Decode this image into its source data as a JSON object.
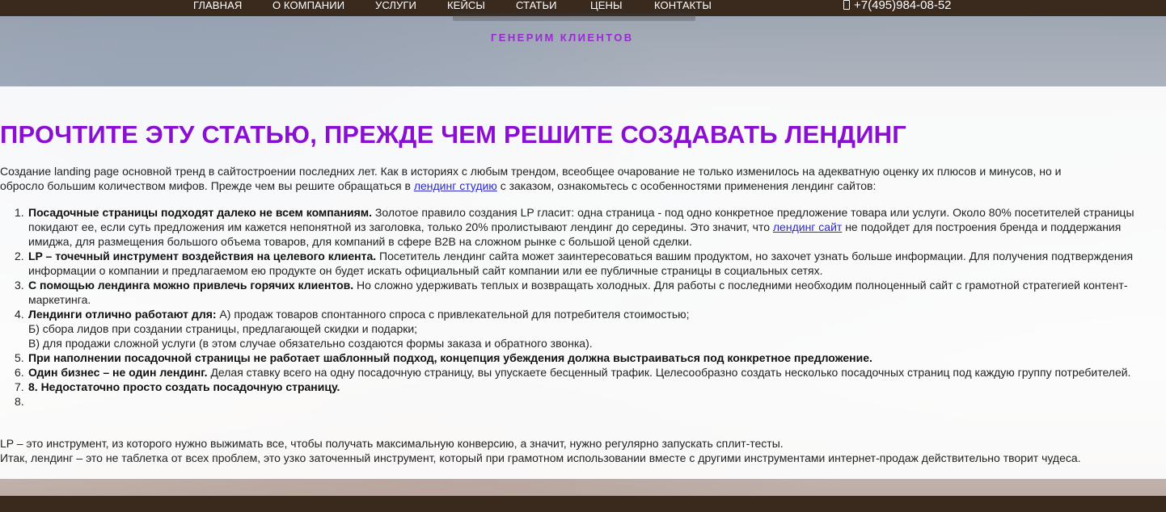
{
  "nav": {
    "items": [
      "ГЛАВНАЯ",
      "О КОМПАНИИ",
      "УСЛУГИ",
      "КЕЙСЫ",
      "СТАТЬИ",
      "ЦЕНЫ",
      "КОНТАКТЫ"
    ],
    "phone": "+7(495)984-08-52",
    "phone_icon": "phone-icon"
  },
  "header": {
    "tagline": "ГЕНЕРИМ КЛИЕНТОВ"
  },
  "article": {
    "title": "ПРОЧТИТЕ ЭТУ СТАТЬЮ, ПРЕЖДЕ ЧЕМ РЕШИТЕ СОЗДАВАТЬ ЛЕНДИНГ",
    "intro_line1": "Создание landing page основной тренд в сайтостроении последних лет. Как в историях с любым трендом, всеобщее очарование не только изменилось на адекватную оценку их плюсов и минусов, но и",
    "intro_line2_a": "обросло большим количеством мифов. Прежде чем вы решите обращаться в ",
    "intro_link": "лендинг студию",
    "intro_line2_b": " с заказом, ознакомьтесь с особенностями применения лендинг сайтов:",
    "items": [
      {
        "num": "1.",
        "bold": "Посадочные страницы подходят далеко не всем компаниям.",
        "text1": " Золотое правило создания LP гласит: одна страница - под одно конкретное предложение товара или услуги. Около 80% посетителей страницы покидают ее, если суть предложения им кажется непонятной из заголовка, только 20% пролистывают лендинг до середины. Это значит, что ",
        "link": "лендинг сайт",
        "text2": " не подойдет для построения бренда и поддержания имиджа, для размещения большого объема товаров, для компаний в сфере B2B на сложном рынке с большой ценой сделки."
      },
      {
        "num": "2.",
        "bold": "LP – точечный инструмент воздействия на целевого клиента.",
        "text1": " Посетитель лендинг сайта может заинтересоваться вашим продуктом, но захочет узнать больше информации. Для получения подтверждения информации о компании и предлагаемом ею продукте он будет искать официальный сайт компании или ее публичные страницы в социальных сетях."
      },
      {
        "num": "3.",
        "bold": "С помощью лендинга можно привлечь горячих клиентов.",
        "text1": " Но сложно удерживать теплых и возвращать холодных. Для работы с последними необходим полноценный сайт с грамотной стратегией контент-маркетинга."
      },
      {
        "num": "4.",
        "bold": "Лендинги отлично работают для:",
        "text1": " А) продаж товаров спонтанного спроса с привлекательной для потребителя стоимостью;",
        "line2": "Б) сбора лидов при создании страницы, предлагающей скидки и подарки;",
        "line3": "В) для продажи сложной услуги (в этом случае обязательно создаются формы заказа и обратного звонка)."
      },
      {
        "num": "5.",
        "bold": "При наполнении посадочной страницы не работает шаблонный подход, концепция убеждения должна выстраиваться под конкретное предложение."
      },
      {
        "num": "6.",
        "bold": "Один бизнес – не один лендинг.",
        "text1": " Делая ставку всего на одну посадочную страницу, вы упускаете бесценный трафик. Целесообразно создать несколько посадочных страниц под каждую группу потребителей."
      },
      {
        "num": "7.",
        "bold": "8. Недостаточно просто создать посадочную страницу."
      },
      {
        "num": "8."
      }
    ],
    "outro1": "LP – это инструмент, из которого нужно выжимать все, чтобы получать максимальную конверсию, а значит, нужно регулярно запускать сплит-тесты.",
    "outro2": "Итак, лендинг – это не таблетка от всех проблем, это узко заточенный инструмент, который при грамотном использовании вместе с другими инструментами интернет-продаж действительно творит чудеса."
  }
}
